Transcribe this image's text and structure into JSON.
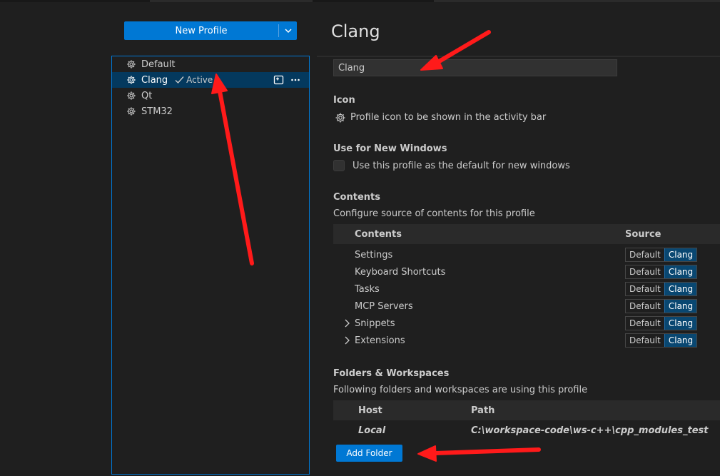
{
  "new_profile_button": {
    "label": "New Profile"
  },
  "profiles": [
    {
      "name": "Default",
      "selected": false
    },
    {
      "name": "Clang",
      "selected": true,
      "active_label": "Active"
    },
    {
      "name": "Qt",
      "selected": false
    },
    {
      "name": "STM32",
      "selected": false
    }
  ],
  "editor": {
    "title": "Clang",
    "name_value": "Clang",
    "icon": {
      "heading": "Icon",
      "description": "Profile icon to be shown in the activity bar"
    },
    "use_for_new_windows": {
      "heading": "Use for New Windows",
      "checkbox_label": "Use this profile as the default for new windows",
      "checked": false
    },
    "contents": {
      "heading": "Contents",
      "description": "Configure source of contents for this profile",
      "col_contents": "Contents",
      "col_source": "Source",
      "rows": [
        {
          "label": "Settings",
          "expandable": false,
          "option_default": "Default",
          "option_profile": "Clang"
        },
        {
          "label": "Keyboard Shortcuts",
          "expandable": false,
          "option_default": "Default",
          "option_profile": "Clang"
        },
        {
          "label": "Tasks",
          "expandable": false,
          "option_default": "Default",
          "option_profile": "Clang"
        },
        {
          "label": "MCP Servers",
          "expandable": false,
          "option_default": "Default",
          "option_profile": "Clang"
        },
        {
          "label": "Snippets",
          "expandable": true,
          "option_default": "Default",
          "option_profile": "Clang"
        },
        {
          "label": "Extensions",
          "expandable": true,
          "option_default": "Default",
          "option_profile": "Clang"
        }
      ]
    },
    "folders": {
      "heading": "Folders & Workspaces",
      "description": "Following folders and workspaces are using this profile",
      "col_host": "Host",
      "col_path": "Path",
      "rows": [
        {
          "host": "Local",
          "path": "C:\\workspace-code\\ws-c++\\cpp_modules_test"
        }
      ],
      "add_button": "Add Folder"
    }
  },
  "colors": {
    "accent": "#0078d4",
    "selection": "#04395e",
    "background": "#1f1f1f",
    "annotation_arrow": "#ff1a1a"
  },
  "icons": [
    "gear-icon",
    "chevron-down-icon",
    "check-icon",
    "new-window-icon",
    "more-icon",
    "chevron-right-icon"
  ]
}
